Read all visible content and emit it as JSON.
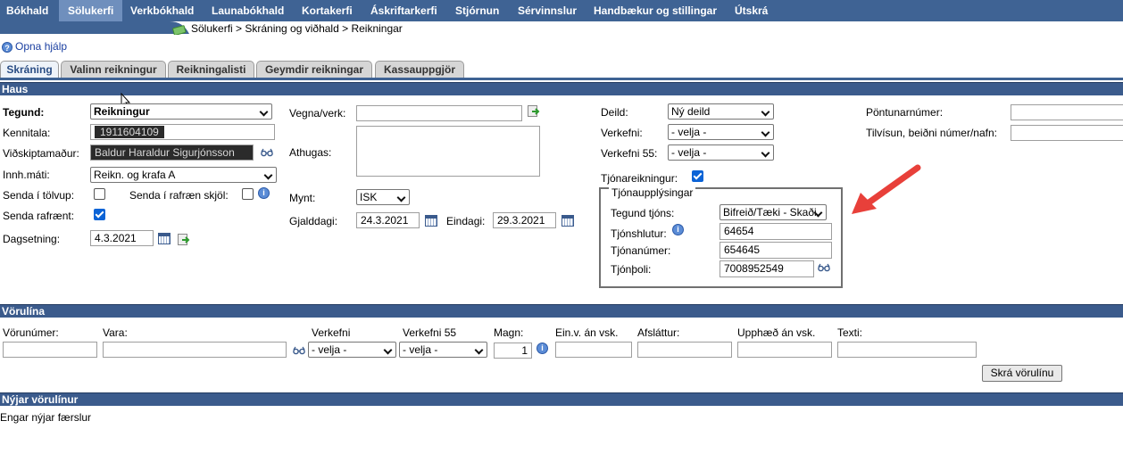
{
  "nav": {
    "items": [
      "Bókhald",
      "Sölukerfi",
      "Verkbókhald",
      "Launabókhald",
      "Kortakerfi",
      "Áskriftarkerfi",
      "Stjórnun",
      "Sérvinnslur",
      "Handbækur og stillingar",
      "Útskrá"
    ],
    "active_index": 1
  },
  "breadcrumb": "Sölukerfi > Skráning og viðhald > Reikningar",
  "help_link": "Opna hjálp",
  "tabs": [
    "Skráning",
    "Valinn reikningur",
    "Reikningalisti",
    "Geymdir reikningar",
    "Kassauppgjör"
  ],
  "sections": {
    "haus": "Haus",
    "vorulina": "Vörulína",
    "nyjar": "Nýjar vörulínur"
  },
  "haus": {
    "tegund_label": "Tegund:",
    "tegund_value": "Reikningur",
    "kennitala_label": "Kennitala:",
    "kennitala_value": "1911604109",
    "vidskiptamadur_label": "Viðskiptamaður:",
    "vidskiptamadur_value": "Baldur Haraldur Sigurjónsson",
    "innh_label": "Innh.máti:",
    "innh_value": "Reikn. og krafa A",
    "senda_tolvup_label": "Senda í tölvup:",
    "senda_skjol_label": "Senda í rafræn skjöl:",
    "senda_rafraent_label": "Senda rafrænt:",
    "dagsetning_label": "Dagsetning:",
    "dagsetning_value": "4.3.2021",
    "vegna_label": "Vegna/verk:",
    "vegna_value": "",
    "athugas_label": "Athugas:",
    "athugas_value": "",
    "mynt_label": "Mynt:",
    "mynt_value": "ISK",
    "gjalddagi_label": "Gjalddagi:",
    "gjalddagi_value": "24.3.2021",
    "eindagi_label": "Eindagi:",
    "eindagi_value": "29.3.2021",
    "deild_label": "Deild:",
    "deild_value": "Ný deild",
    "verkefni_label": "Verkefni:",
    "verkefni_value": "- velja -",
    "verkefni55_label": "Verkefni 55:",
    "verkefni55_value": "- velja -",
    "tjonareikningur_label": "Tjónareikningur:",
    "pontun_label": "Pöntunarnúmer:",
    "pontun_value": "",
    "tilvisun_label": "Tilvísun, beiðni númer/nafn:",
    "tilvisun_value": ""
  },
  "tjon": {
    "legend": "Tjónaupplýsingar",
    "tegund_label": "Tegund tjóns:",
    "tegund_value": "Bifreið/Tæki - Skaði",
    "hlutur_label": "Tjónshlutur:",
    "hlutur_value": "64654",
    "numer_label": "Tjónanúmer:",
    "numer_value": "654645",
    "poli_label": "Tjónþoli:",
    "poli_value": "7008952549"
  },
  "vorulina": {
    "vorunumer_label": "Vörunúmer:",
    "vara_label": "Vara:",
    "verkefni_label": "Verkefni",
    "verkefni_value": "- velja -",
    "verkefni55_label": "Verkefni 55",
    "verkefni55_value": "- velja -",
    "magn_label": "Magn:",
    "magn_value": "1",
    "einv_label": "Ein.v. án vsk.",
    "afslattur_label": "Afsláttur:",
    "upphaed_label": "Upphæð án vsk.",
    "texti_label": "Texti:",
    "submit_label": "Skrá vörulínu"
  },
  "nyjar_empty": "Engar nýjar færslur",
  "colors": {
    "nav_bg": "#3f6394",
    "section_bg": "#3b5b8c",
    "accent_arrow": "#e8403a",
    "checkbox": "#0b63d6"
  }
}
